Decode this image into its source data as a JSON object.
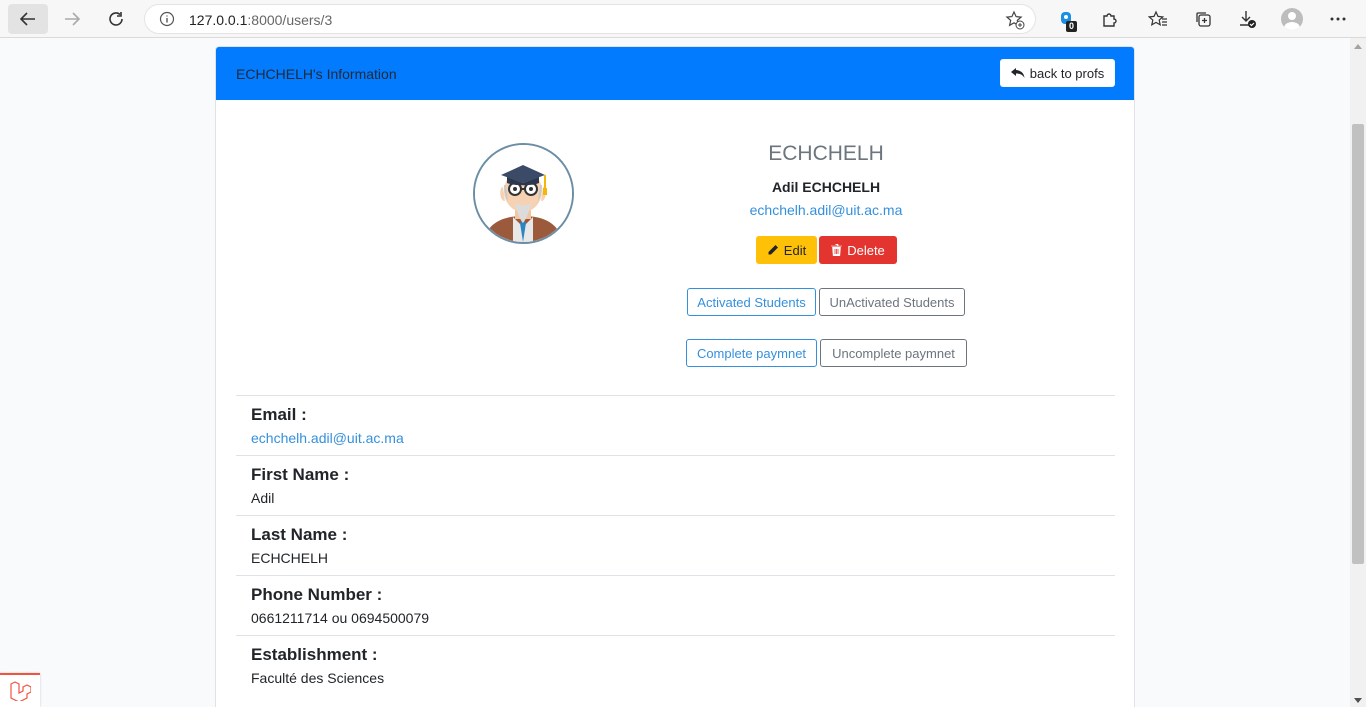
{
  "browser": {
    "url_host": "127.0.0.1",
    "url_rest": ":8000/users/3",
    "extension_badge": "0"
  },
  "card": {
    "header_title": "ECHCHELH's Information",
    "back_button": "back to profs"
  },
  "profile": {
    "username": "ECHCHELH",
    "full_name": "Adil ECHCHELH",
    "email": "echchelh.adil@uit.ac.ma"
  },
  "actions": {
    "edit": "Edit",
    "delete": "Delete",
    "activated": "Activated Students",
    "unactivated": "UnActivated Students",
    "complete": "Complete paymnet",
    "uncomplete": "Uncomplete paymnet"
  },
  "details": [
    {
      "label": "Email :",
      "value": "echchelh.adil@uit.ac.ma"
    },
    {
      "label": "First Name :",
      "value": "Adil"
    },
    {
      "label": "Last Name :",
      "value": "ECHCHELH"
    },
    {
      "label": "Phone Number :",
      "value": "0661211714 ou 0694500079"
    },
    {
      "label": "Establishment :",
      "value": "Faculté des Sciences"
    }
  ],
  "colors": {
    "primary": "#037bfe",
    "warning": "#ffc107",
    "danger": "#e3342f",
    "link": "#3490dc"
  },
  "icons": [
    "back-arrow-icon",
    "forward-arrow-icon",
    "reload-icon",
    "info-icon",
    "favorite-add-icon",
    "extension-icon",
    "puzzle-icon",
    "favorites-icon",
    "collections-icon",
    "downloads-icon",
    "profile-icon",
    "more-icon",
    "reply-icon",
    "pencil-icon",
    "trash-icon",
    "laravel-icon"
  ]
}
